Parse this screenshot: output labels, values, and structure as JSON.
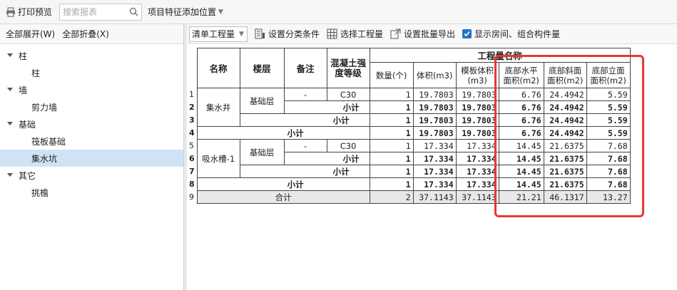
{
  "topbar": {
    "print_label": "打印预览",
    "search_placeholder": "搜索报表",
    "feature_position_label": "项目特征添加位置"
  },
  "left_toolbar": {
    "expand_all": "全部展开(W)",
    "collapse_all": "全部折叠(X)"
  },
  "tree": [
    {
      "label": "柱",
      "children": [
        "柱"
      ]
    },
    {
      "label": "墙",
      "children": [
        "剪力墙"
      ]
    },
    {
      "label": "基础",
      "children": [
        "筏板基础",
        "集水坑"
      ]
    },
    {
      "label": "其它",
      "children": [
        "挑檐"
      ]
    }
  ],
  "right_toolbar": {
    "select_value": "清单工程量",
    "set_category": "设置分类条件",
    "select_quantity": "选择工程量",
    "batch_export": "设置批量导出",
    "show_rooms": "显示房间、组合构件量"
  },
  "table": {
    "headers": {
      "name": "名称",
      "floor": "楼层",
      "note": "备注",
      "grade": "混凝土强度等级",
      "group": "工程量名称",
      "count": "数量(个)",
      "volume": "体积(m3)",
      "formwork": "模板体积(m3)",
      "bottom_h": "底部水平面积(m2)",
      "bottom_slope": "底部斜面面积(m2)",
      "bottom_v": "底部立面面积(m2)"
    },
    "rows": [
      {
        "rn": "1",
        "grade": "C30",
        "count": "1",
        "volume": "19.7803",
        "formwork": "19.7803",
        "bh": "6.76",
        "bs": "24.4942",
        "bv": "5.59"
      },
      {
        "rn": "2",
        "grade": "小计",
        "count": "1",
        "volume": "19.7803",
        "formwork": "19.7803",
        "bh": "6.76",
        "bs": "24.4942",
        "bv": "5.59"
      },
      {
        "rn": "3",
        "subtotal": "小计",
        "count": "1",
        "volume": "19.7803",
        "formwork": "19.7803",
        "bh": "6.76",
        "bs": "24.4942",
        "bv": "5.59"
      },
      {
        "rn": "4",
        "subtotal": "小计",
        "count": "1",
        "volume": "19.7803",
        "formwork": "19.7803",
        "bh": "6.76",
        "bs": "24.4942",
        "bv": "5.59"
      },
      {
        "rn": "5",
        "grade": "C30",
        "count": "1",
        "volume": "17.334",
        "formwork": "17.334",
        "bh": "14.45",
        "bs": "21.6375",
        "bv": "7.68"
      },
      {
        "rn": "6",
        "grade": "小计",
        "count": "1",
        "volume": "17.334",
        "formwork": "17.334",
        "bh": "14.45",
        "bs": "21.6375",
        "bv": "7.68"
      },
      {
        "rn": "7",
        "subtotal": "小计",
        "count": "1",
        "volume": "17.334",
        "formwork": "17.334",
        "bh": "14.45",
        "bs": "21.6375",
        "bv": "7.68"
      },
      {
        "rn": "8",
        "subtotal": "小计",
        "count": "1",
        "volume": "17.334",
        "formwork": "17.334",
        "bh": "14.45",
        "bs": "21.6375",
        "bv": "7.68"
      },
      {
        "rn": "9",
        "total": "合计",
        "count": "2",
        "volume": "37.1143",
        "formwork": "37.1143",
        "bh": "21.21",
        "bs": "46.1317",
        "bv": "13.27"
      }
    ],
    "group1": {
      "name": "集水井",
      "floor": "基础层",
      "note": "-"
    },
    "group2": {
      "name": "吸水槽-1",
      "floor": "基础层",
      "note": "-"
    }
  },
  "colors": {
    "accent": "#1e73c9",
    "highlight": "#e53935",
    "selected_row": "#cfe3f7"
  }
}
